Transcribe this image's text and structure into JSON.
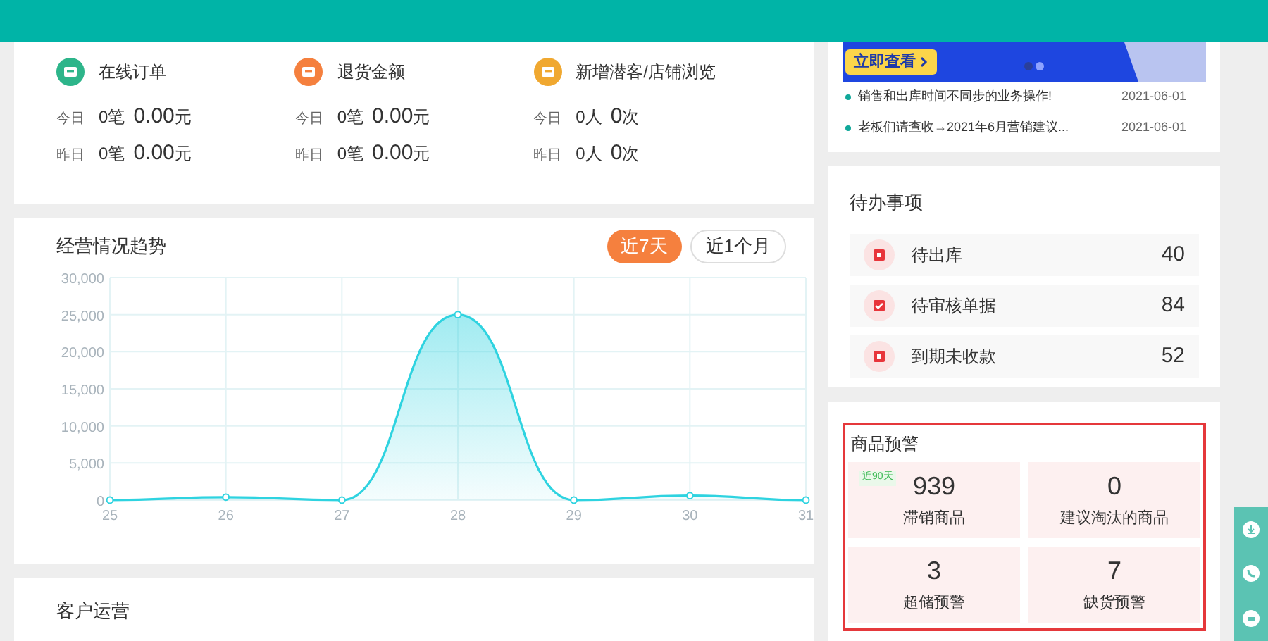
{
  "overview": {
    "metrics": [
      {
        "kind": "order",
        "title": "在线订单",
        "rows": [
          {
            "label": "今日",
            "count": "0笔",
            "amount": "0.00",
            "unit": "元"
          },
          {
            "label": "昨日",
            "count": "0笔",
            "amount": "0.00",
            "unit": "元"
          }
        ]
      },
      {
        "kind": "return",
        "title": "退货金额",
        "rows": [
          {
            "label": "今日",
            "count": "0笔",
            "amount": "0.00",
            "unit": "元"
          },
          {
            "label": "昨日",
            "count": "0笔",
            "amount": "0.00",
            "unit": "元"
          }
        ]
      },
      {
        "kind": "visitor",
        "title": "新增潜客/店铺浏览",
        "rows": [
          {
            "label": "今日",
            "count": "0人",
            "amount": "0",
            "unit": "次"
          },
          {
            "label": "昨日",
            "count": "0人",
            "amount": "0",
            "unit": "次"
          }
        ]
      }
    ]
  },
  "trend": {
    "title": "经营情况趋势",
    "ranges": [
      {
        "label": "近7天",
        "selected": true
      },
      {
        "label": "近1个月",
        "selected": false
      }
    ],
    "chart_data": {
      "type": "area",
      "categories": [
        "25",
        "26",
        "27",
        "28",
        "29",
        "30",
        "31"
      ],
      "grid": true,
      "series": [
        {
          "color": "#2ed3e0",
          "values": [
            0,
            400,
            0,
            25000,
            0,
            600,
            0
          ]
        }
      ],
      "ylim": [
        0,
        30000
      ],
      "yticks": [
        {
          "value": 0,
          "label": "0"
        },
        {
          "value": 5000,
          "label": "5,000"
        },
        {
          "value": 10000,
          "label": "10,000"
        },
        {
          "value": 15000,
          "label": "15,000"
        },
        {
          "value": 20000,
          "label": "20,000"
        },
        {
          "value": 25000,
          "label": "25,000"
        },
        {
          "value": 30000,
          "label": "30,000"
        }
      ]
    }
  },
  "customer": {
    "title": "客户运营"
  },
  "banner": {
    "button": "立即查看"
  },
  "news": [
    {
      "title": "销售和出库时间不同步的业务操作!",
      "date": "2021-06-01"
    },
    {
      "title": "老板们请查收→2021年6月营销建议...",
      "date": "2021-06-01"
    }
  ],
  "todo": {
    "title": "待办事项",
    "items": [
      {
        "kind": "outbound",
        "label": "待出库",
        "count": "40"
      },
      {
        "kind": "review",
        "label": "待审核单据",
        "count": "84"
      },
      {
        "kind": "receivable",
        "label": "到期未收款",
        "count": "52"
      }
    ]
  },
  "warning": {
    "title": "商品预警",
    "tiles": [
      {
        "value": "939",
        "label": "滞销商品",
        "tag": "近90天"
      },
      {
        "value": "0",
        "label": "建议淘汰的商品"
      },
      {
        "value": "3",
        "label": "超储预警"
      },
      {
        "value": "7",
        "label": "缺货预警"
      }
    ]
  }
}
